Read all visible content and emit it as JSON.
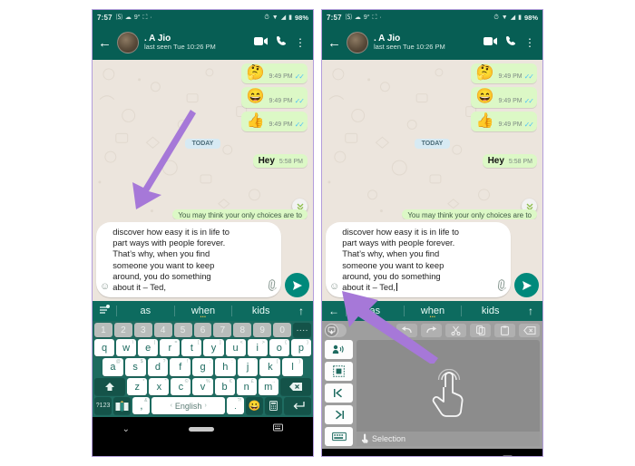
{
  "status_bar": {
    "time": "7:57",
    "left_icons": [
      "whatsapp-icon",
      "cloud-icon",
      "signal-icon",
      "network-icon",
      "dot-icon"
    ],
    "right_icons": [
      "alarm-icon",
      "wifi-icon",
      "signal-bars-icon"
    ],
    "battery": "98%"
  },
  "chat_header": {
    "back": "←",
    "contact_name": ". A Jio",
    "status": "last seen Tue 10:26 PM",
    "video_icon": "▶",
    "call_icon": "✆",
    "menu_icon": "⋮"
  },
  "chat": {
    "messages": [
      {
        "emoji": "🤔",
        "time": "9:49 PM",
        "ticks": "✓✓"
      },
      {
        "emoji": "😄",
        "time": "9:49 PM",
        "ticks": "✓✓"
      },
      {
        "emoji": "👍",
        "time": "9:49 PM",
        "ticks": "✓✓"
      }
    ],
    "day_divider": "TODAY",
    "last_message": {
      "text": "Hey",
      "time": "5:58 PM"
    },
    "clipped_bubble": "You may think your only choices are to",
    "scroll_down_icon": "»"
  },
  "composer": {
    "emoji_icon": "☺",
    "message": "discover how easy it is in life to\npart ways with people forever.\nThat’s why, when you find\nsomeone you want to keep\naround, you do something\nabout it – Ted,",
    "attach_icon": "📎",
    "send_icon": "➤"
  },
  "suggestions": {
    "left_icon_keyboard": "☰",
    "left_icon_back": "←",
    "words": [
      "as",
      "when",
      "kids"
    ],
    "right_icon": "↑"
  },
  "keyboard": {
    "number_row": [
      "1",
      "2",
      "3",
      "4",
      "5",
      "6",
      "7",
      "8",
      "9",
      "0"
    ],
    "number_row_extra": "····",
    "row1": [
      {
        "k": "q",
        "alt": ""
      },
      {
        "k": "w",
        "alt": "\\"
      },
      {
        "k": "e",
        "alt": "|"
      },
      {
        "k": "r",
        "alt": "="
      },
      {
        "k": "t",
        "alt": "["
      },
      {
        "k": "y",
        "alt": "]"
      },
      {
        "k": "u",
        "alt": "<"
      },
      {
        "k": "i",
        "alt": ">"
      },
      {
        "k": "o",
        "alt": "{"
      },
      {
        "k": "p",
        "alt": "}"
      }
    ],
    "row2": [
      {
        "k": "a",
        "alt": "@"
      },
      {
        "k": "s",
        "alt": "$"
      },
      {
        "k": "d",
        "alt": "?"
      },
      {
        "k": "f",
        "alt": "!"
      },
      {
        "k": "g",
        "alt": ";"
      },
      {
        "k": "h",
        "alt": ":"
      },
      {
        "k": "j",
        "alt": "'"
      },
      {
        "k": "k",
        "alt": "("
      },
      {
        "k": "l",
        "alt": ")"
      }
    ],
    "row3": [
      {
        "k": "z",
        "alt": "*"
      },
      {
        "k": "x",
        "alt": "\""
      },
      {
        "k": "c",
        "alt": "©"
      },
      {
        "k": "v",
        "alt": "%"
      },
      {
        "k": "b",
        "alt": "€"
      },
      {
        "k": "n",
        "alt": "£"
      },
      {
        "k": "m",
        "alt": "→"
      }
    ],
    "shift_icon": "⬆",
    "backspace_icon": "✕",
    "symbols_key": "?123",
    "cursor_key_icon": "cursor-control-icon",
    "comma_key": ",",
    "space_label": "English",
    "space_left_dot": "‹",
    "space_right_dot": "›",
    "period_key": ".",
    "emoji_key": "😀",
    "calculator_key": "▦",
    "enter_icon": "↵"
  },
  "cursor_panel": {
    "toggle_icon": "cursor-pad-toggle-icon",
    "tools": [
      {
        "name": "undo-button",
        "icon": "↶"
      },
      {
        "name": "redo-button",
        "icon": "↷"
      },
      {
        "name": "cut-button",
        "icon": "✂"
      },
      {
        "name": "copy-button",
        "icon": "⧉"
      },
      {
        "name": "paste-button",
        "icon": "❐"
      },
      {
        "name": "backspace-button",
        "icon": "⌫"
      }
    ],
    "side_buttons": [
      {
        "name": "voice-select-button",
        "icon": "🔊"
      },
      {
        "name": "select-all-button",
        "icon": "❑"
      },
      {
        "name": "move-to-start-button",
        "icon": "|‹"
      },
      {
        "name": "move-to-end-button",
        "icon": "›|"
      },
      {
        "name": "keyboard-button",
        "icon": "⌨"
      }
    ],
    "touchpad_hand_icon": "👆",
    "selection_label": "Selection",
    "selection_icon": "☝"
  },
  "nav_bar": {
    "back_icon": "⌄",
    "home_icon": "home-pill",
    "keyboard_icon": "⌨"
  },
  "colors": {
    "whatsapp_teal": "#075E54",
    "keyboard_green": "#1e6b60",
    "bubble_green": "#dcf8c6",
    "chat_bg": "#ece5dd",
    "send_green": "#00897b",
    "arrow_purple": "#a678d8"
  }
}
